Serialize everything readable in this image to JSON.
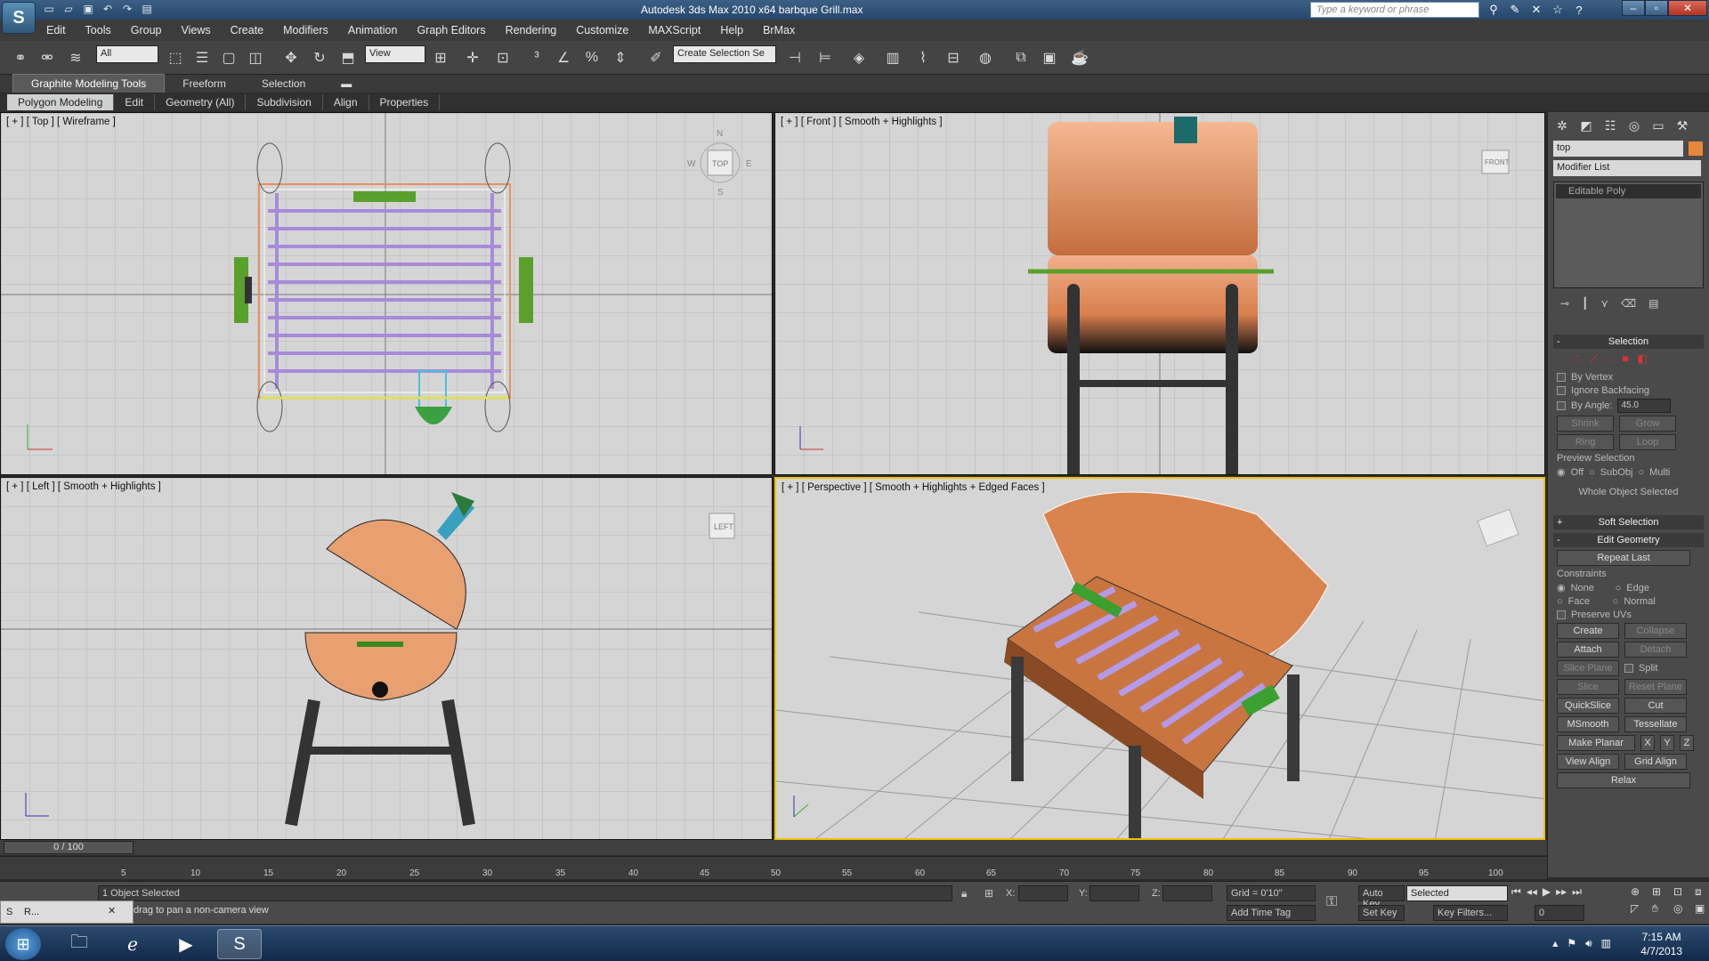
{
  "app": {
    "title": "Autodesk 3ds Max  2010 x64      barbque Grill.max",
    "logo_icon": "3dsmax-logo-icon",
    "search_placeholder": "Type a keyword or phrase"
  },
  "menu": [
    "Edit",
    "Tools",
    "Group",
    "Views",
    "Create",
    "Modifiers",
    "Animation",
    "Graph Editors",
    "Rendering",
    "Customize",
    "MAXScript",
    "Help",
    "BrMax"
  ],
  "toolbar": {
    "selection_filter": "All",
    "ref_coord": "View",
    "named_selection": "Create Selection Se"
  },
  "ribbon": {
    "tabs": [
      "Graphite Modeling Tools",
      "Freeform",
      "Selection"
    ],
    "subtabs": [
      "Polygon Modeling",
      "Edit",
      "Geometry (All)",
      "Subdivision",
      "Align",
      "Properties"
    ]
  },
  "viewports": {
    "top": {
      "label": "[ + ] [ Top ] [ Wireframe ]",
      "cube": "TOP",
      "compass": [
        "N",
        "E",
        "S",
        "W"
      ]
    },
    "front": {
      "label": "[ + ] [ Front ] [ Smooth + Highlights ]",
      "cube": "FRONT"
    },
    "left": {
      "label": "[ + ] [ Left ] [ Smooth + Highlights ]",
      "cube": "LEFT"
    },
    "persp": {
      "label": "[ + ] [ Perspective ] [ Smooth + Highlights + Edged Faces ]"
    }
  },
  "command_panel": {
    "object_name": "top",
    "object_color": "#e8863a",
    "modifier_list": "Modifier List",
    "stack_item": "Editable Poly",
    "selection": {
      "title": "Selection",
      "by_vertex": "By Vertex",
      "ignore_backfacing": "Ignore Backfacing",
      "by_angle": "By Angle:",
      "angle": "45.0",
      "shrink": "Shrink",
      "grow": "Grow",
      "ring": "Ring",
      "loop": "Loop",
      "preview": "Preview Selection",
      "off": "Off",
      "subobj": "SubObj",
      "multi": "Multi",
      "whole": "Whole Object Selected"
    },
    "soft_selection": "Soft Selection",
    "edit_geometry": {
      "title": "Edit Geometry",
      "repeat_last": "Repeat Last",
      "constraints": "Constraints",
      "none": "None",
      "edge": "Edge",
      "face": "Face",
      "normal": "Normal",
      "preserve_uvs": "Preserve UVs",
      "create": "Create",
      "collapse": "Collapse",
      "attach": "Attach",
      "detach": "Detach",
      "slice_plane": "Slice Plane",
      "split": "Split",
      "slice": "Slice",
      "reset_plane": "Reset Plane",
      "quickslice": "QuickSlice",
      "cut": "Cut",
      "msmooth": "MSmooth",
      "tessellate": "Tessellate",
      "make_planar": "Make Planar",
      "x": "X",
      "y": "Y",
      "z": "Z",
      "view_align": "View Align",
      "grid_align": "Grid Align",
      "relax": "Relax"
    }
  },
  "timeline": {
    "slider": "0 / 100",
    "ticks": [
      "5",
      "10",
      "15",
      "20",
      "25",
      "30",
      "35",
      "40",
      "45",
      "50",
      "55",
      "60",
      "65",
      "70",
      "75",
      "80",
      "85",
      "90",
      "95",
      "100"
    ]
  },
  "status": {
    "objects_selected": "1 Object Selected",
    "prompt": "drag to pan a non-camera view",
    "x_label": "X:",
    "y_label": "Y:",
    "z_label": "Z:",
    "grid": "Grid = 0'10\"",
    "add_time_tag": "Add Time Tag",
    "auto_key": "Auto Key",
    "set_key": "Set Key",
    "key_mode": "Selected",
    "key_filters": "Key Filters...",
    "frame": "0",
    "mini_label": "R..."
  },
  "taskbar": {
    "time": "7:15 AM",
    "date": "4/7/2013"
  }
}
